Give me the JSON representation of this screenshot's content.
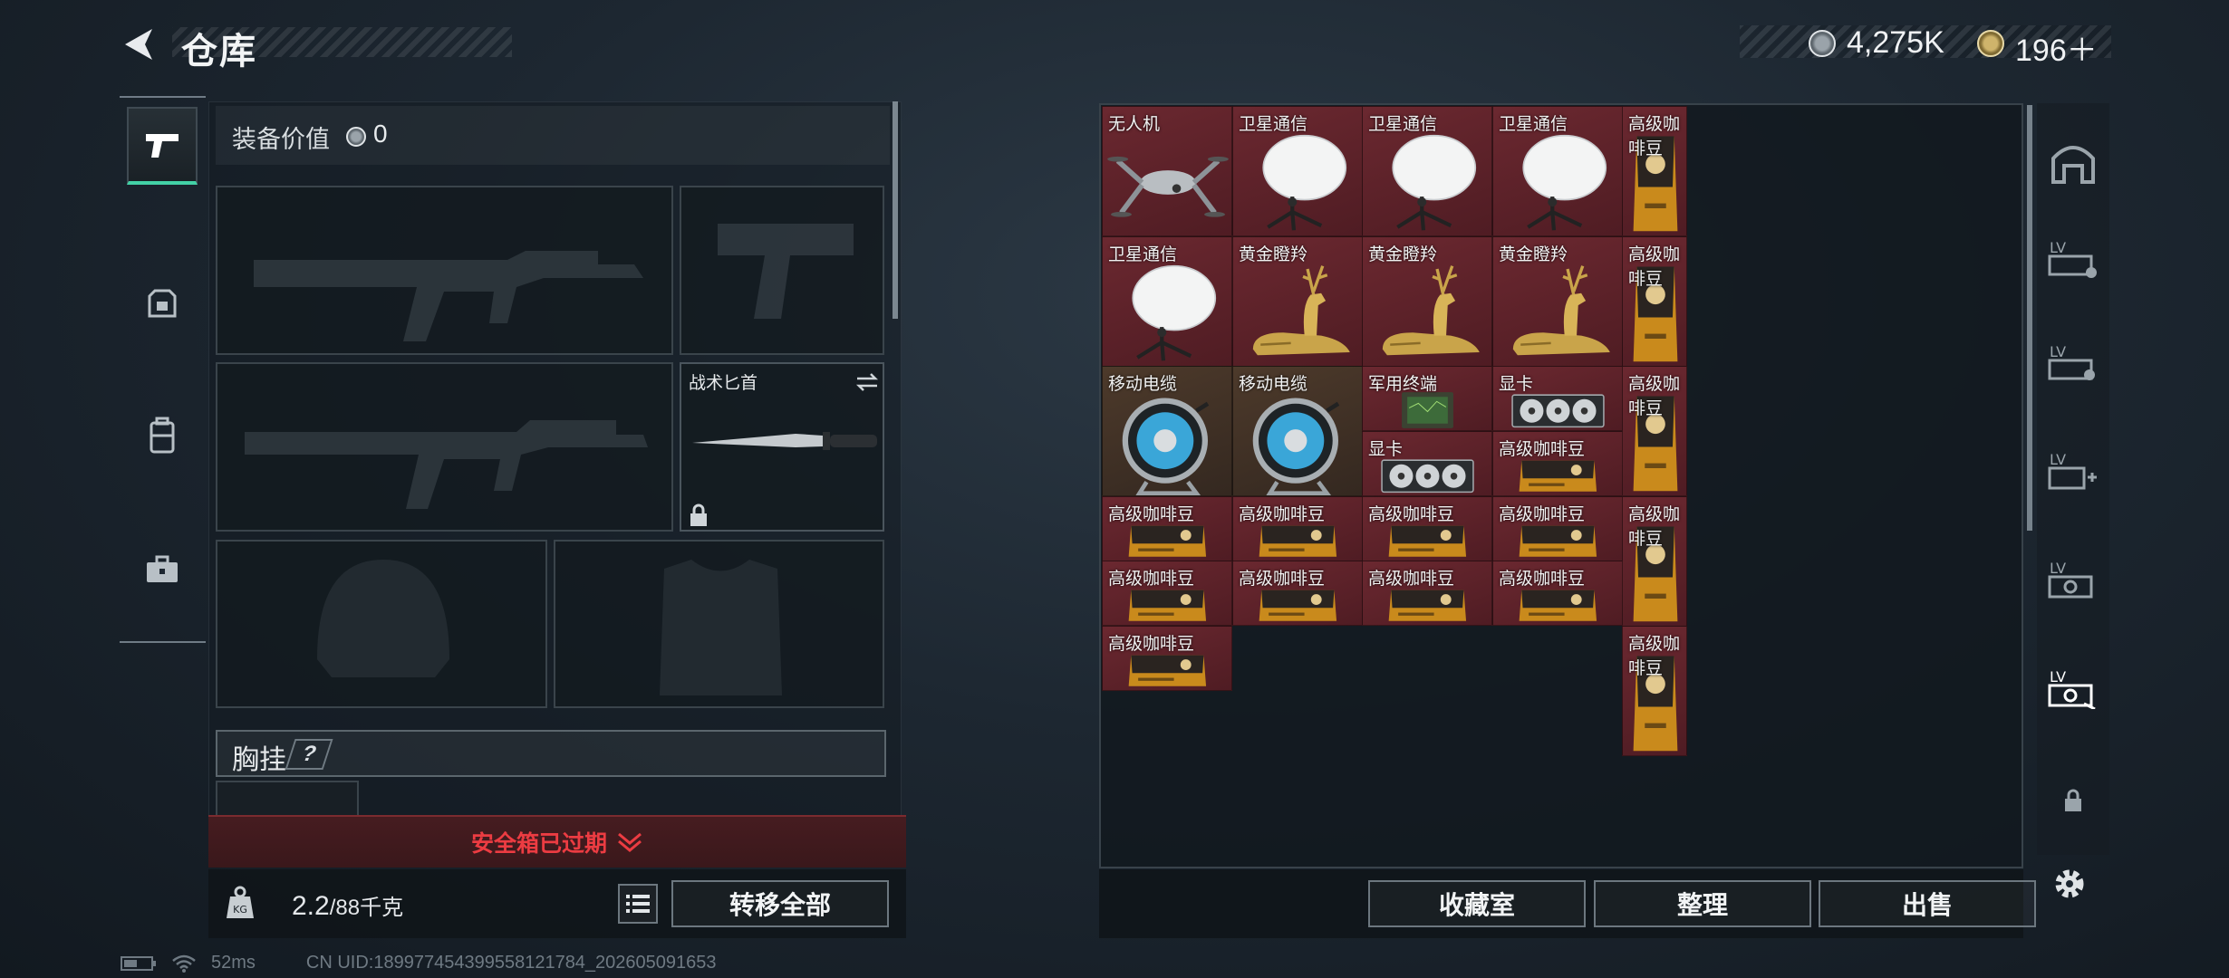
{
  "header": {
    "title": "仓库",
    "silver": "4,275K",
    "gold": "196＋"
  },
  "left": {
    "value_label": "装备价值",
    "value_amount": "0",
    "knife_label": "战术匕首",
    "chest_label": "胸挂",
    "chest_badge": "?",
    "safe_box": "安全箱已过期",
    "weight": "2.2",
    "weight_max": "/88千克",
    "transfer_all": "转移全部"
  },
  "inventory": {
    "items": [
      {
        "label": "无人机",
        "icon": "drone"
      },
      {
        "label": "卫星通信",
        "icon": "satellite-dish"
      },
      {
        "label": "卫星通信",
        "icon": "satellite-dish"
      },
      {
        "label": "卫星通信",
        "icon": "satellite-dish"
      },
      {
        "label": "高级咖啡豆",
        "icon": "coffee-bag"
      },
      {
        "label": "卫星通信",
        "icon": "satellite-dish"
      },
      {
        "label": "黄金瞪羚",
        "icon": "golden-gazelle"
      },
      {
        "label": "黄金瞪羚",
        "icon": "golden-gazelle"
      },
      {
        "label": "黄金瞪羚",
        "icon": "golden-gazelle"
      },
      {
        "label": "高级咖啡豆",
        "icon": "coffee-bag"
      },
      {
        "label": "移动电缆",
        "icon": "cable-reel"
      },
      {
        "label": "移动电缆",
        "icon": "cable-reel"
      },
      {
        "label": "军用终端",
        "icon": "military-terminal"
      },
      {
        "label": "显卡",
        "icon": "graphics-card"
      },
      {
        "label": "高级咖啡豆",
        "icon": "coffee-bag"
      },
      {
        "label": "显卡",
        "icon": "graphics-card"
      },
      {
        "label": "高级咖啡豆",
        "icon": "coffee-bag"
      },
      {
        "label": "高级咖啡豆",
        "icon": "coffee-bag"
      },
      {
        "label": "高级咖啡豆",
        "icon": "coffee-bag"
      },
      {
        "label": "高级咖啡豆",
        "icon": "coffee-bag"
      },
      {
        "label": "高级咖啡豆",
        "icon": "coffee-bag"
      },
      {
        "label": "高级咖啡豆",
        "icon": "coffee-bag"
      },
      {
        "label": "高级咖啡豆",
        "icon": "coffee-bag"
      },
      {
        "label": "高级咖啡豆",
        "icon": "coffee-bag"
      },
      {
        "label": "高级咖啡豆",
        "icon": "coffee-bag"
      },
      {
        "label": "高级咖啡豆",
        "icon": "coffee-bag"
      },
      {
        "label": "高级咖啡豆",
        "icon": "coffee-bag"
      },
      {
        "label": "高级咖啡豆",
        "icon": "coffee-bag"
      }
    ]
  },
  "footer": {
    "collection": "收藏室",
    "organize": "整理",
    "sell": "出售"
  },
  "status": {
    "ping": "52ms",
    "uid": "CN UID:189977454399558121784_202605091653"
  },
  "colors": {
    "accent": "#43d1a6",
    "alert": "#ec3c42",
    "rare_bg": "#5e2229"
  }
}
